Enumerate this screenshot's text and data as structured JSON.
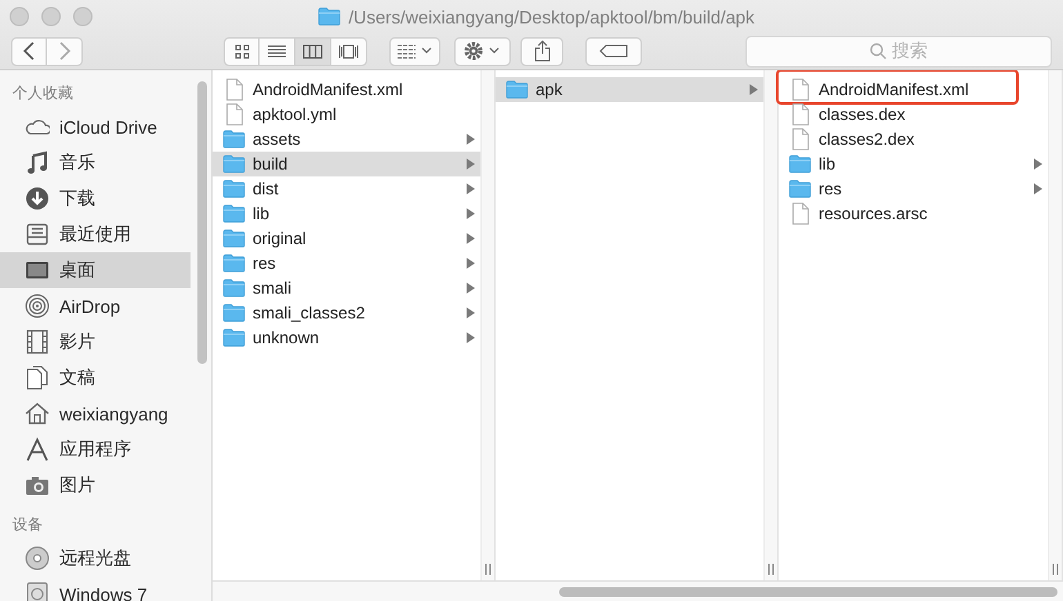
{
  "window": {
    "title": "/Users/weixiangyang/Desktop/apktool/bm/build/apk"
  },
  "toolbar": {
    "view_modes": [
      {
        "selected": false
      },
      {
        "selected": false
      },
      {
        "selected": true
      },
      {
        "selected": false
      }
    ],
    "search": {
      "placeholder": "搜索"
    }
  },
  "sidebar": {
    "sections": [
      {
        "heading": "个人收藏",
        "items": [
          {
            "label": "iCloud Drive",
            "selected": false
          },
          {
            "label": "音乐",
            "selected": false
          },
          {
            "label": "下载",
            "selected": false
          },
          {
            "label": "最近使用",
            "selected": false
          },
          {
            "label": "桌面",
            "selected": true
          },
          {
            "label": "AirDrop",
            "selected": false
          },
          {
            "label": "影片",
            "selected": false
          },
          {
            "label": "文稿",
            "selected": false
          },
          {
            "label": "weixiangyang",
            "selected": false
          },
          {
            "label": "应用程序",
            "selected": false
          },
          {
            "label": "图片",
            "selected": false
          }
        ]
      },
      {
        "heading": "设备",
        "items": [
          {
            "label": "远程光盘",
            "selected": false
          },
          {
            "label": "Windows 7",
            "selected": false
          }
        ]
      }
    ]
  },
  "columns": [
    {
      "items": [
        {
          "name": "AndroidManifest.xml",
          "kind": "file",
          "selected": false
        },
        {
          "name": "apktool.yml",
          "kind": "file",
          "selected": false
        },
        {
          "name": "assets",
          "kind": "folder",
          "selected": false
        },
        {
          "name": "build",
          "kind": "folder",
          "selected": true
        },
        {
          "name": "dist",
          "kind": "folder",
          "selected": false
        },
        {
          "name": "lib",
          "kind": "folder",
          "selected": false
        },
        {
          "name": "original",
          "kind": "folder",
          "selected": false
        },
        {
          "name": "res",
          "kind": "folder",
          "selected": false
        },
        {
          "name": "smali",
          "kind": "folder",
          "selected": false
        },
        {
          "name": "smali_classes2",
          "kind": "folder",
          "selected": false
        },
        {
          "name": "unknown",
          "kind": "folder",
          "selected": false
        }
      ]
    },
    {
      "items": [
        {
          "name": "apk",
          "kind": "folder",
          "selected": true
        }
      ]
    },
    {
      "items": [
        {
          "name": "AndroidManifest.xml",
          "kind": "file",
          "selected": false,
          "highlighted": true
        },
        {
          "name": "classes.dex",
          "kind": "file",
          "selected": false
        },
        {
          "name": "classes2.dex",
          "kind": "file",
          "selected": false
        },
        {
          "name": "lib",
          "kind": "folder",
          "selected": false
        },
        {
          "name": "res",
          "kind": "folder",
          "selected": false
        },
        {
          "name": "resources.arsc",
          "kind": "file",
          "selected": false
        }
      ]
    }
  ]
}
